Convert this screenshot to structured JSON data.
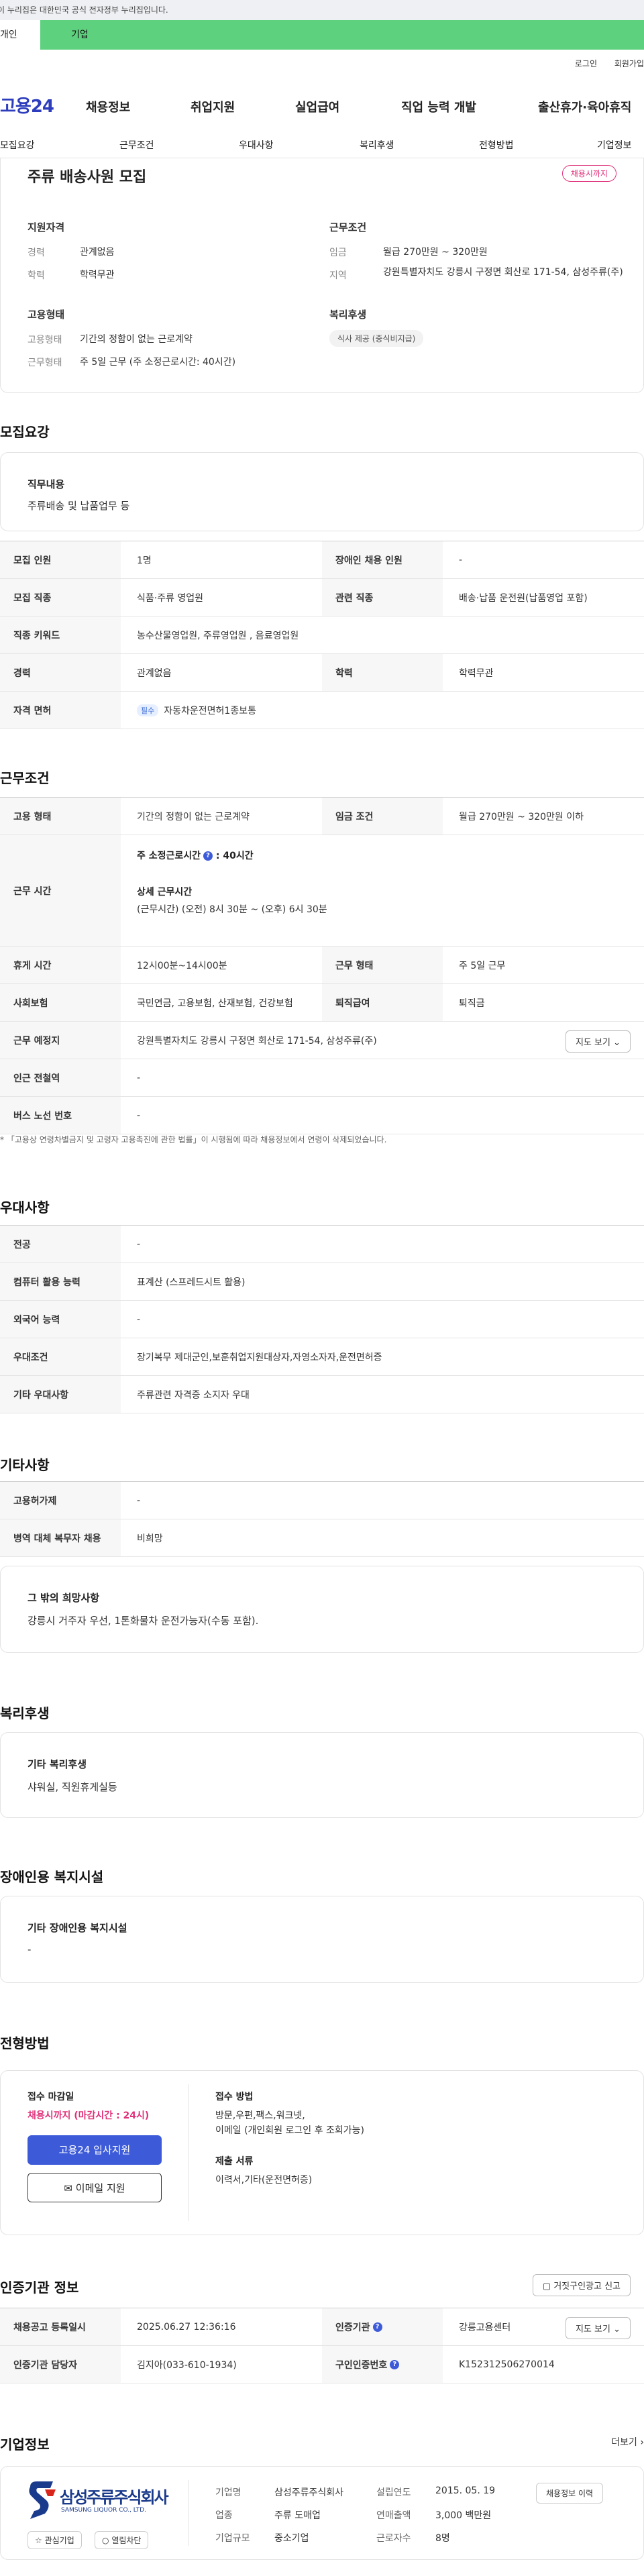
{
  "gov_banner": "이 누리집은 대한민국 공식 전자정부 누리집입니다.",
  "tabs": {
    "person": "개인",
    "company": "기업"
  },
  "util": {
    "login": "로그인",
    "signup": "회원가입"
  },
  "logo": {
    "text": "고용24"
  },
  "gnb": [
    "채용정보",
    "취업지원",
    "실업급여",
    "직업 능력 개발",
    "출산휴가·육아휴직"
  ],
  "subnav": [
    "모집요강",
    "근무조건",
    "우대사항",
    "복리후생",
    "전형방법",
    "기업정보"
  ],
  "summary": {
    "title": "주류 배송사원 모집",
    "deadline_badge": "채용시까지",
    "qualification_label": "지원자격",
    "career_key": "경력",
    "career_val": "관계없음",
    "edu_key": "학력",
    "edu_val": "학력무관",
    "conditions_label": "근무조건",
    "wage_key": "임금",
    "wage_val": "월급 270만원 ~ 320만원",
    "region_key": "지역",
    "region_val": "강원특별자치도 강릉시 구정면 회산로 171-54, 삼성주류(주)",
    "employment_label": "고용형태",
    "emptype_key": "고용형태",
    "emptype_val": "기간의 정함이 없는 근로계약",
    "worktype_key": "근무형태",
    "worktype_val": "주 5일 근무 (주 소정근로시간: 40시간)",
    "welfare_label": "복리후생",
    "welfare_chip": "식사 제공 (중식비지급)"
  },
  "recruit": {
    "section_title": "모집요강",
    "duty_title": "직무내용",
    "duty_text": "주류배송 및 납품업무 등",
    "rows": [
      {
        "k1": "모집 인원",
        "v1": "1명",
        "k2": "장애인 채용 인원",
        "v2": "-"
      },
      {
        "k1": "모집 직종",
        "v1": "식품·주류 영업원",
        "k2": "관련 직종",
        "v2": "배송·납품 운전원(납품영업 포함)"
      },
      {
        "k1": "직종 키워드",
        "v1": "농수산물영업원, 주류영업원 , 음료영업원"
      },
      {
        "k1": "경력",
        "v1": "관계없음",
        "k2": "학력",
        "v2": "학력무관"
      },
      {
        "k1": "자격 면허",
        "chip": "필수",
        "v1": "자동차운전면허1종보통"
      }
    ]
  },
  "work": {
    "section_title": "근무조건",
    "r1": {
      "k1": "고용 형태",
      "v1": "기간의 정함이 없는 근로계약",
      "k2": "임금 조건",
      "v2": "월급 270만원 ~ 320만원 이하"
    },
    "r2": {
      "k1": "근무 시간",
      "a": "주 소정근로시간",
      "b": ": 40시간",
      "c": "상세 근무시간",
      "d": "(근무시간) (오전) 8시 30분 ~ (오후) 6시 30분"
    },
    "r3": {
      "k1": "휴게 시간",
      "v1": "12시00분~14시00분",
      "k2": "근무 형태",
      "v2": "주 5일 근무"
    },
    "r4": {
      "k1": "사회보험",
      "v1": "국민연금, 고용보험, 산재보험, 건강보험",
      "k2": "퇴직급여",
      "v2": "퇴직금"
    },
    "r5": {
      "k1": "근무 예정지",
      "v1": "강원특별자치도 강릉시 구정면 회산로 171-54, 삼성주류(주)",
      "btn": "지도 보기"
    },
    "r6": {
      "k1": "인근 전철역",
      "v1": "-"
    },
    "r7": {
      "k1": "버스 노선 번호",
      "v1": "-"
    },
    "note": "* 「고용상 연령차별금지 및 고령자 고용촉진에 관한 법률」이 시행됨에 따라 채용정보에서 연령이 삭제되었습니다."
  },
  "pref": {
    "section_title": "우대사항",
    "rows": [
      {
        "k": "전공",
        "v": "-"
      },
      {
        "k": "컴퓨터 활용 능력",
        "v": "표계산 (스프레드시트 활용)"
      },
      {
        "k": "외국어 능력",
        "v": "-"
      },
      {
        "k": "우대조건",
        "v": "장기복무 제대군인,보훈취업지원대상자,자영소자자,운전면허증"
      },
      {
        "k": "기타 우대사항",
        "v": "주류관련 자격증 소지자 우대"
      }
    ]
  },
  "etc": {
    "section_title": "기타사항",
    "rows": [
      {
        "k": "고용허가제",
        "v": "-"
      },
      {
        "k": "병역 대체 복무자 채용",
        "v": "비희망"
      }
    ],
    "wish_title": "그 밖의 희망사항",
    "wish_text": "강릉시 거주자 우선, 1톤화물차 운전가능자(수동 포함)."
  },
  "welfare": {
    "section_title": "복리후생",
    "box_title": "기타 복리후생",
    "box_text": "샤워실, 직원휴게실등"
  },
  "disability": {
    "section_title": "장애인용 복지시설",
    "box_title": "기타 장애인용 복지시설",
    "box_text": "-"
  },
  "process": {
    "section_title": "전형방법",
    "deadline_label": "접수 마감일",
    "deadline_val": "채용시까지 (마감시간 : 24시)",
    "apply_btn": "고용24 입사지원",
    "email_btn": "이메일 지원",
    "method_label": "접수 방법",
    "method_val1": "방문,우편,팩스,워크넷,",
    "method_val2": "이메일 (개인회원 로그인 후 조회가능)",
    "docs_label": "제출 서류",
    "docs_val": "이력서,기타(운전면허증)"
  },
  "cert": {
    "section_title": "인증기관 정보",
    "report_btn": "거짓구인광고 신고",
    "r1": {
      "k1": "채용공고 등록일시",
      "v1": "2025.06.27 12:36:16",
      "k2": "인증기관",
      "v2": "강릉고용센터",
      "btn": "지도 보기"
    },
    "r2": {
      "k1": "인증기관 담당자",
      "v1": "김지아(033-610-1934)",
      "k2": "구인인증번호",
      "v2": "K152312506270014"
    }
  },
  "company": {
    "section_title": "기업정보",
    "more": "더보기",
    "logo_korean": "삼성주류주식회사",
    "logo_english": "SAMSUNG LIQUOR CO., LTD.",
    "name_k": "기업명",
    "name_v": "삼성주류주식회사",
    "ind_k": "업종",
    "ind_v": "주류 도매업",
    "size_k": "기업규모",
    "size_v": "중소기업",
    "est_k": "설립연도",
    "est_v": "2015. 05. 19",
    "sales_k": "연매출액",
    "sales_v": "3,000 백만원",
    "emp_k": "근로자수",
    "emp_v": "8명",
    "history_btn": "채용정보 이력",
    "interest_btn": "관심기업",
    "alarm_btn": "열림차단"
  }
}
